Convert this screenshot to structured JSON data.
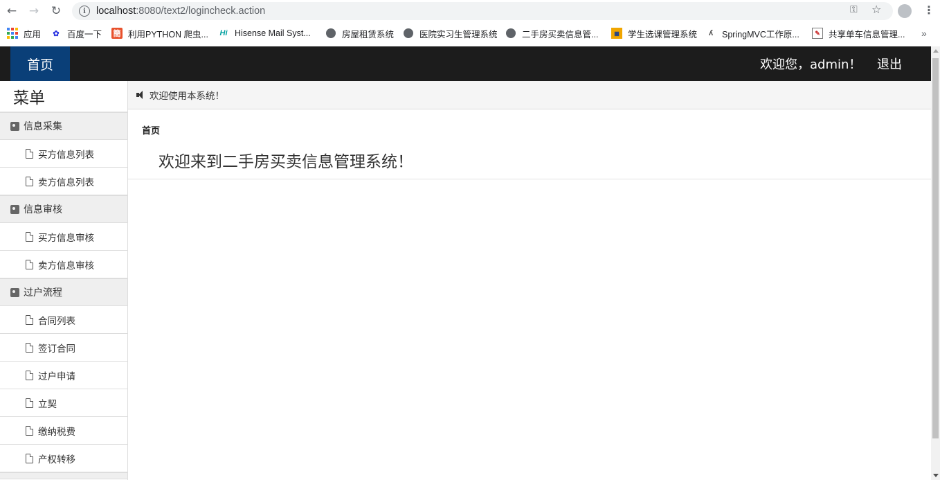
{
  "browser": {
    "url_host": "localhost",
    "url_rest": ":8080/text2/logincheck.action",
    "bookmarks": [
      {
        "label": "应用",
        "icon": "apps-icon"
      },
      {
        "label": "百度一下",
        "icon": "baidu-icon"
      },
      {
        "label": "利用PYTHON 爬虫...",
        "icon": "jian-icon"
      },
      {
        "label": "Hisense Mail Syst...",
        "icon": "hisense-icon"
      },
      {
        "label": "房屋租赁系统",
        "icon": "globe-icon"
      },
      {
        "label": "医院实习生管理系统",
        "icon": "globe-icon"
      },
      {
        "label": "二手房买卖信息管...",
        "icon": "globe-icon"
      },
      {
        "label": "学生选课管理系统",
        "icon": "school-icon"
      },
      {
        "label": "SpringMVC工作原...",
        "icon": "spring-icon"
      },
      {
        "label": "共享单车信息管理...",
        "icon": "bike-icon"
      }
    ]
  },
  "header": {
    "home_label": "首页",
    "welcome": "欢迎您，admin！",
    "logout": "退出"
  },
  "sidebar": {
    "title": "菜单",
    "groups": [
      {
        "label": "信息采集",
        "items": [
          "买方信息列表",
          "卖方信息列表"
        ]
      },
      {
        "label": "信息审核",
        "items": [
          "买方信息审核",
          "卖方信息审核"
        ]
      },
      {
        "label": "过户流程",
        "items": [
          "合同列表",
          "签订合同",
          "过户申请",
          "立契",
          "缴纳税费",
          "产权转移"
        ]
      }
    ]
  },
  "main": {
    "notice": "欢迎使用本系统！",
    "breadcrumb": "首页",
    "welcome_title": "欢迎来到二手房买卖信息管理系统！"
  }
}
